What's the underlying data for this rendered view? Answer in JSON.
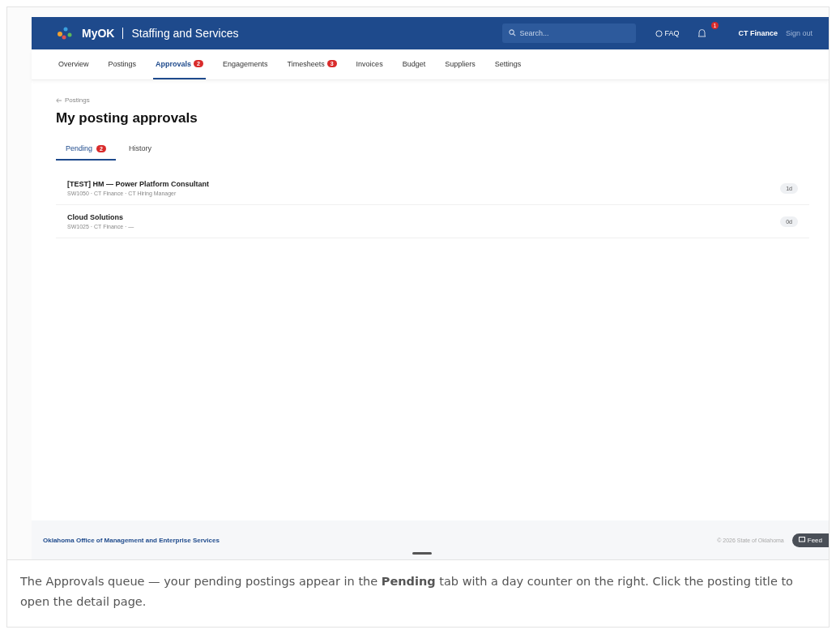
{
  "header": {
    "brand": "MyOK",
    "title": "Staffing and Services",
    "search": {
      "placeholder": "Search..."
    },
    "faq": "FAQ",
    "notifications": "1",
    "user": "CT Finance",
    "sign_out": "Sign out"
  },
  "nav": [
    {
      "label": "Overview",
      "selected": false
    },
    {
      "label": "Postings",
      "selected": false
    },
    {
      "label": "Approvals",
      "selected": true,
      "badge": "2"
    },
    {
      "label": "Engagements",
      "selected": false
    },
    {
      "label": "Timesheets",
      "selected": false,
      "badge": "3"
    },
    {
      "label": "Invoices",
      "selected": false
    },
    {
      "label": "Budget",
      "selected": false
    },
    {
      "label": "Suppliers",
      "selected": false
    },
    {
      "label": "Settings",
      "selected": false
    }
  ],
  "breadcrumb": "Postings",
  "page_title": "My posting approvals",
  "tabs": [
    {
      "label": "Pending",
      "selected": true,
      "badge": "2"
    },
    {
      "label": "History",
      "selected": false
    }
  ],
  "approvals": [
    {
      "title": "[TEST] HM — Power Platform Consultant",
      "meta": "SW1050 · CT Finance · CT Hiring Manager",
      "age": "1d"
    },
    {
      "title": "Cloud Solutions",
      "meta": "SW1025 · CT Finance · —",
      "age": "0d"
    }
  ],
  "footer": {
    "agency": "Oklahoma Office of Management and Enterprise Services",
    "copyright": "© 2026 State of Oklahoma",
    "feedback": "Feed"
  },
  "caption": "The Approvals queue — your pending postings appear in the **Pending** tab with a day counter on the right. Click the posting title to open the detail page."
}
